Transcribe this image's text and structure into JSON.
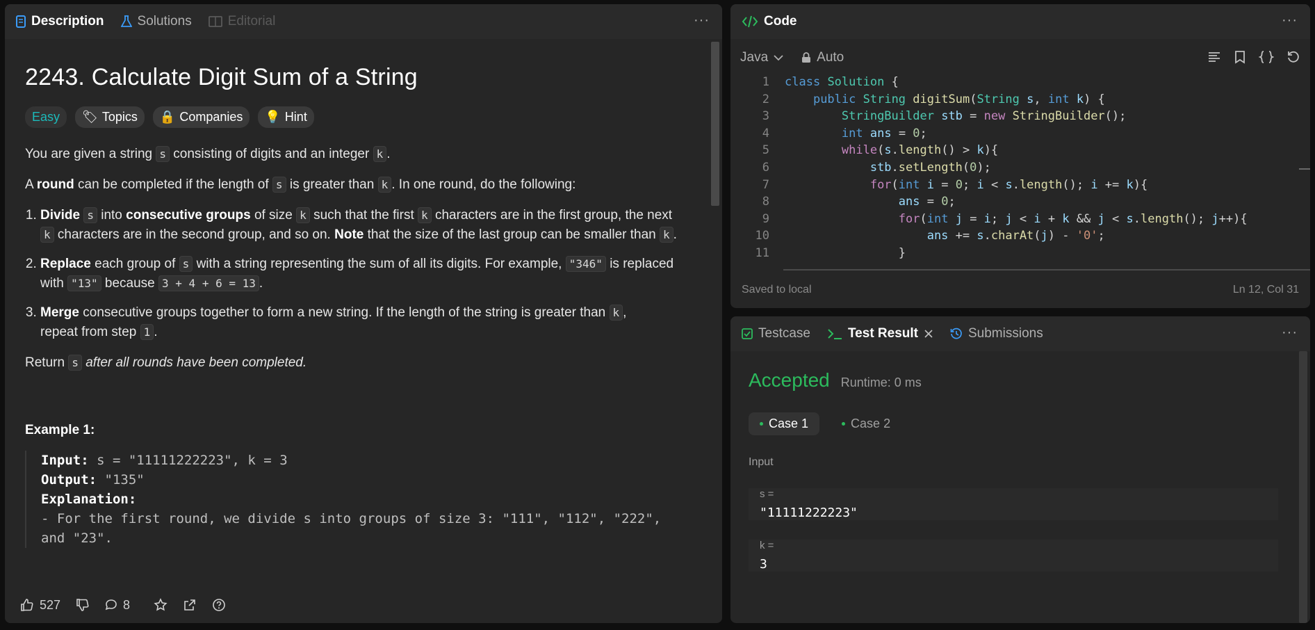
{
  "left": {
    "tabs": [
      {
        "label": "Description"
      },
      {
        "label": "Solutions"
      },
      {
        "label": "Editorial"
      }
    ],
    "title": "2243. Calculate Digit Sum of a String",
    "tags": {
      "difficulty": "Easy",
      "topics": "Topics",
      "companies": "Companies",
      "hint": "Hint"
    },
    "p1": [
      "You are given a string ",
      "s",
      " consisting of digits and an integer ",
      "k",
      "."
    ],
    "p2": [
      "A ",
      "round",
      " can be completed if the length of ",
      "s",
      " is greater than ",
      "k",
      ". In one round, do the following:"
    ],
    "li1": [
      "Divide",
      "s",
      "into",
      "consecutive groups",
      "of size",
      "k",
      "such that the first",
      "k",
      "characters are in the first group, the next",
      "k",
      "characters are in the second group, and so on.",
      "Note",
      "that the size of the last group can be smaller than",
      "k",
      "."
    ],
    "li2": [
      "Replace",
      "each group of",
      "s",
      "with a string representing the sum of all its digits. For example,",
      "\"346\"",
      "is replaced with",
      "\"13\"",
      "because",
      "3 + 4 + 6 = 13",
      "."
    ],
    "li3": [
      "Merge",
      "consecutive groups together to form a new string. If the length of the string is greater than",
      "k",
      ",",
      "repeat from step",
      "1",
      "."
    ],
    "ret": [
      "Return ",
      "s",
      " after all rounds have been completed."
    ],
    "example_title": "Example 1:",
    "example": {
      "input_label": "Input:",
      "input": "s = \"11111222223\", k = 3",
      "output_label": "Output:",
      "output": "\"135\"",
      "explanation_label": "Explanation:",
      "exp1": "- For the first round, we divide s into groups of size 3: \"111\", \"112\", \"222\",",
      "exp2": "and \"23\"."
    },
    "bottom": {
      "likes": "527",
      "comments": "8"
    }
  },
  "code": {
    "title": "Code",
    "language": "Java",
    "mode": "Auto",
    "footer_left": "Saved to local",
    "footer_right": "Ln 12, Col 31",
    "line_numbers": [
      "1",
      "2",
      "3",
      "4",
      "5",
      "6",
      "7",
      "8",
      "9",
      "10",
      "11"
    ]
  },
  "result": {
    "tabs": [
      {
        "label": "Testcase"
      },
      {
        "label": "Test Result"
      },
      {
        "label": "Submissions"
      }
    ],
    "status": "Accepted",
    "runtime": "Runtime: 0 ms",
    "cases": [
      "Case 1",
      "Case 2"
    ],
    "input_label": "Input",
    "vars": [
      {
        "name": "s =",
        "value": "\"11111222223\""
      },
      {
        "name": "k =",
        "value": "3"
      }
    ]
  },
  "colors": {
    "accent_green": "#2cbb5d",
    "easy": "#1cbaba",
    "bg": "#262626"
  }
}
